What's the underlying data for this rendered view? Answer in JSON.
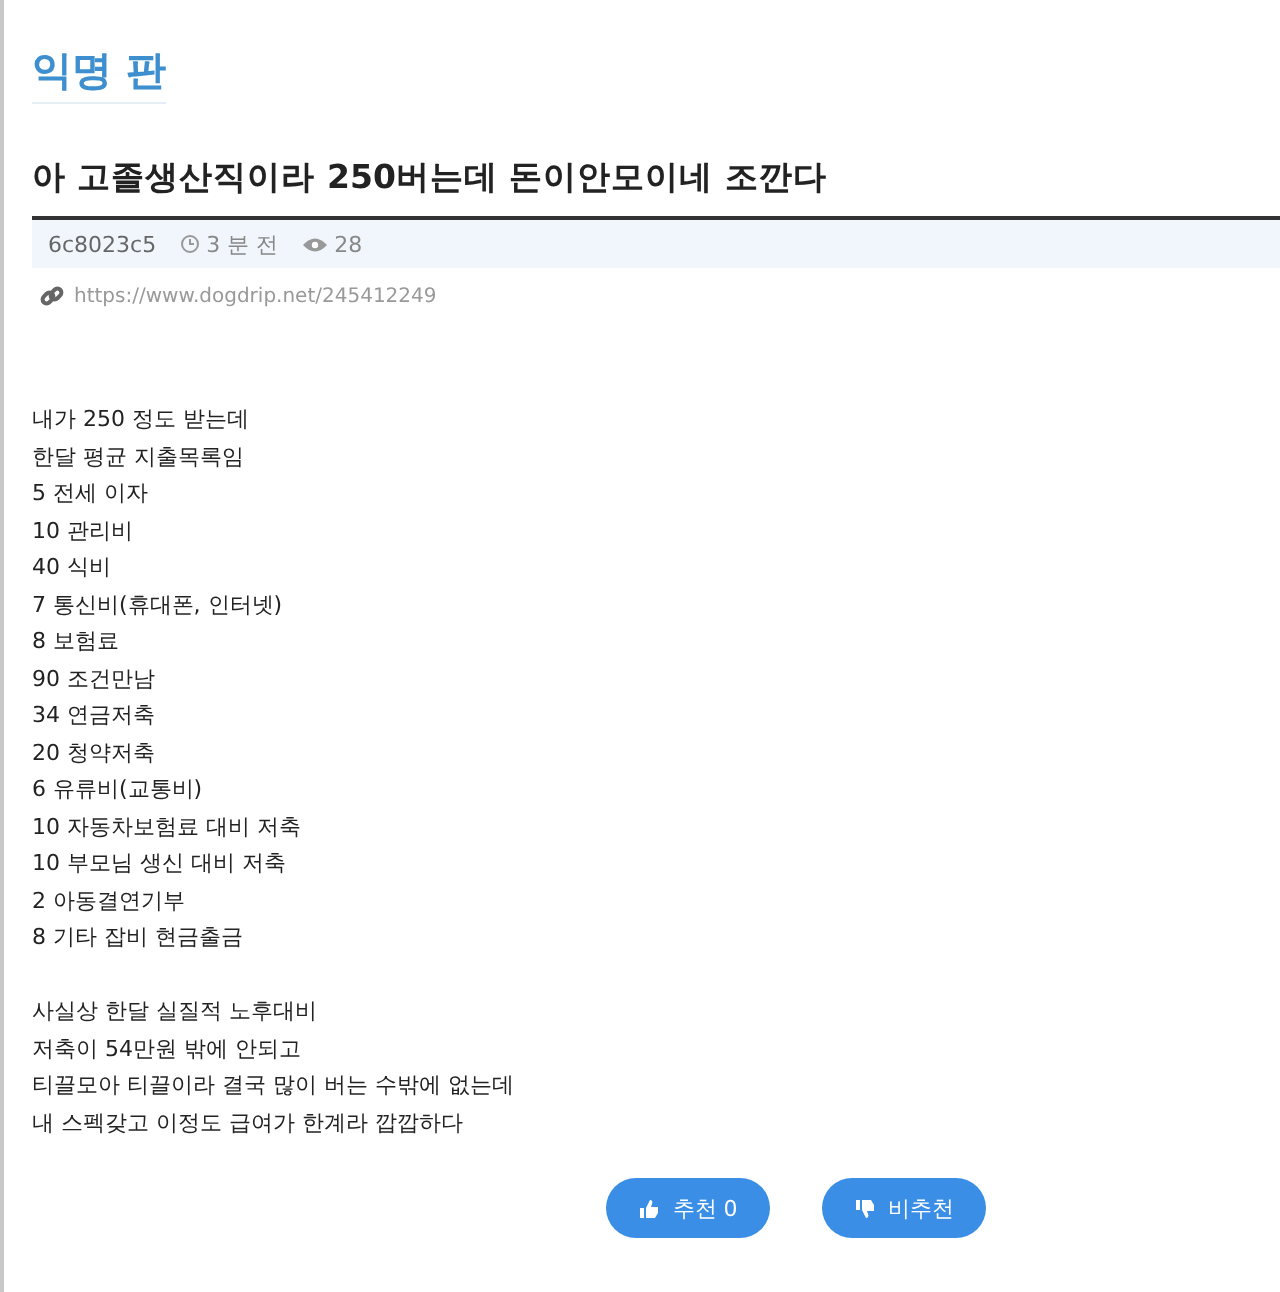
{
  "board": {
    "title": "익명 판"
  },
  "post": {
    "title": "아 고졸생산직이라 250버는데 돈이안모이네 조깐다",
    "author": "6c8023c5",
    "time": "3 분 전",
    "views": "28",
    "link": "https://www.dogdrip.net/245412249"
  },
  "body": [
    [
      "내가 250 정도 받는데",
      "한달 평균 지출목록임",
      "5 전세 이자",
      "10 관리비",
      "40 식비",
      "7 통신비(휴대폰, 인터넷)",
      "8 보험료",
      "90 조건만남",
      "34 연금저축",
      "20 청약저축",
      "6 유류비(교통비)",
      "10 자동차보험료 대비 저축",
      "10 부모님 생신 대비 저축",
      "2 아동결연기부",
      "8 기타 잡비 현금출금"
    ],
    [
      "사실상 한달 실질적 노후대비",
      "저축이 54만원 밖에 안되고",
      "티끌모아 티끌이라 결국 많이 버는 수밖에 없는데",
      "내 스펙갖고 이정도 급여가 한계라 깝깝하다"
    ]
  ],
  "buttons": [
    {
      "kind": "upvote",
      "label": "추천 0"
    },
    {
      "kind": "downvote",
      "label": "비추천"
    }
  ]
}
